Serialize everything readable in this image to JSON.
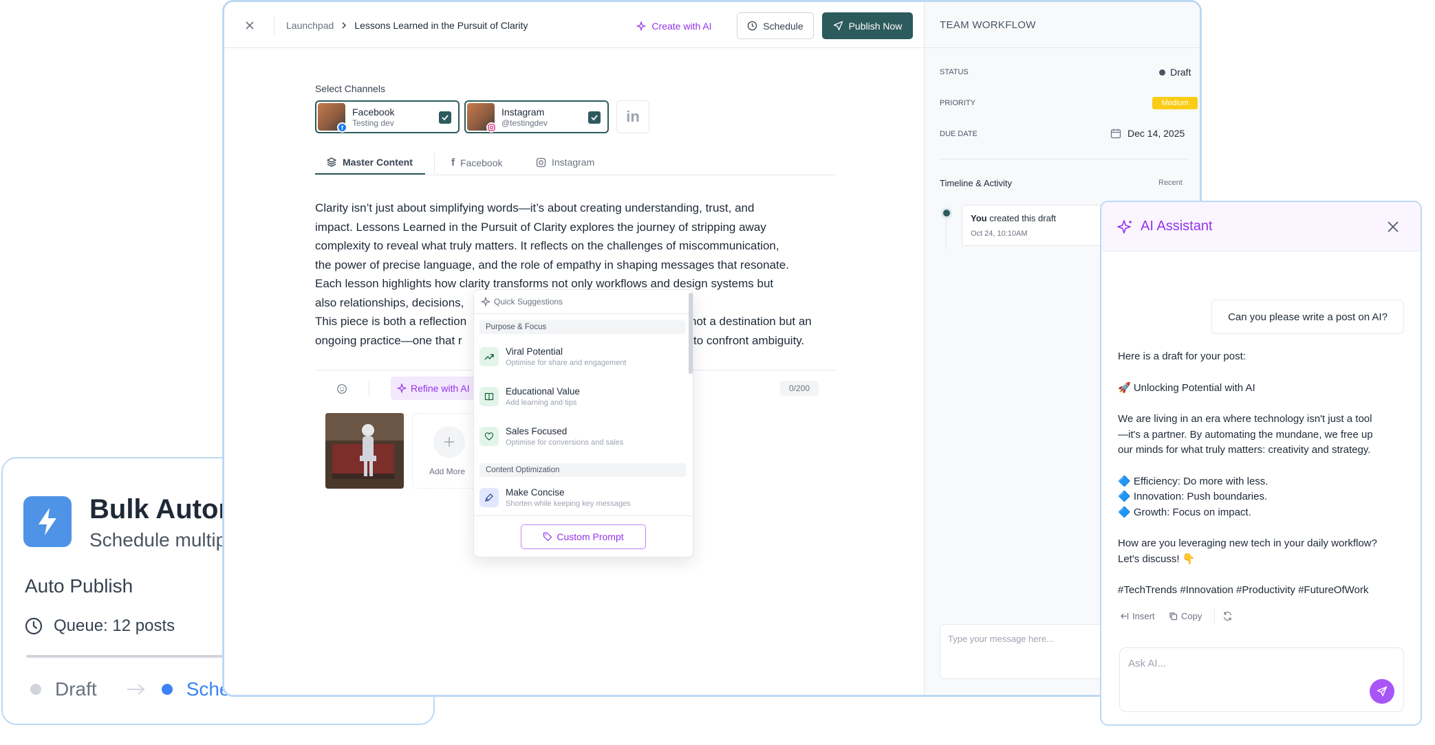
{
  "bulk": {
    "icon": "lightning-icon",
    "title": "Bulk Autom",
    "subtitle": "Schedule multip",
    "auto_publish": "Auto Publish",
    "queue": "Queue: 12 posts",
    "flow_draft": "Draft",
    "flow_scheduled": "Sched"
  },
  "header": {
    "breadcrumb_root": "Launchpad",
    "breadcrumb_current": "Lessons Learned in the Pursuit of Clarity",
    "create_ai": "Create with AI",
    "schedule": "Schedule",
    "publish": "Publish Now"
  },
  "channels": {
    "label": "Select Channels",
    "items": [
      {
        "name": "Facebook",
        "handle": "Testing dev"
      },
      {
        "name": "Instagram",
        "handle": "@testingdev"
      }
    ]
  },
  "tabs": [
    "Master Content",
    "Facebook",
    "Instagram"
  ],
  "content": {
    "text_lines": [
      "Clarity isn’t just about simplifying words—it’s about creating understanding, trust, and",
      "impact. Lessons Learned in the Pursuit of Clarity explores the journey of stripping away",
      "complexity to reveal what truly matters. It reflects on the challenges of miscommunication,",
      "the power of precise language, and the role of empathy in shaping messages that resonate.",
      "Each lesson highlights how clarity transforms not only workflows and design systems but",
      "also relationships, decisions,",
      "This piece is both a reflection",
      "ongoing practice—one that r"
    ],
    "text_tail_1": "not a destination but an",
    "text_tail_2": "to confront ambiguity.",
    "refine": "Refine with AI",
    "char_count": "0/200",
    "add_more": "Add More"
  },
  "quick_suggestions": {
    "header": "Quick Suggestions",
    "section1": "Purpose & Focus",
    "items1": [
      {
        "title": "Viral Potential",
        "desc": "Optimise for share and engagement",
        "icon": "trending-up-icon"
      },
      {
        "title": "Educational Value",
        "desc": "Add learning and tips",
        "icon": "book-icon"
      },
      {
        "title": "Sales Focused",
        "desc": "Optimise for conversions and sales",
        "icon": "heart-icon"
      }
    ],
    "section2": "Content Optimization",
    "items2": [
      {
        "title": "Make Concise",
        "desc": "Shorten while keeping key messages",
        "icon": "pen-icon"
      }
    ],
    "custom_prompt": "Custom Prompt"
  },
  "workflow": {
    "title": "TEAM WORKFLOW",
    "status_label": "STATUS",
    "status_value": "Draft",
    "priority_label": "PRIORITY",
    "priority_value": "Medium",
    "due_label": "DUE DATE",
    "due_value": "Dec 14, 2025",
    "timeline_title": "Timeline & Activity",
    "timeline_recent": "Recent",
    "activity_actor": "You",
    "activity_text": "created this draft",
    "activity_time": "Oct 24, 10:10AM",
    "message_placeholder": "Type your message here..."
  },
  "ai": {
    "title": "AI Assistant",
    "user_msg": "Can you please write a post on AI?",
    "intro": "Here is a draft for your post:",
    "headline": "🚀 Unlocking Potential with AI",
    "para_lines": [
      "We are living in an era where technology isn't just a tool",
      "—it's a partner. By automating the mundane, we free up",
      "our minds for what truly matters: creativity and strategy."
    ],
    "bullets": [
      "🔷 Efficiency: Do more with less.",
      "🔷 Innovation: Push boundaries.",
      "🔷 Growth: Focus on impact."
    ],
    "question_lines": [
      "How are you leveraging new tech in your daily workflow?",
      "Let's discuss! 👇"
    ],
    "hashtags": "#TechTrends #Innovation #Productivity #FutureOfWork",
    "insert": "Insert",
    "copy": "Copy",
    "input_placeholder": "Ask AI..."
  },
  "colors": {
    "accent_teal": "#2d5a5d",
    "ai_purple": "#9333ea",
    "priority_bg": "#facc15",
    "border_blue": "#bcd9f4"
  }
}
